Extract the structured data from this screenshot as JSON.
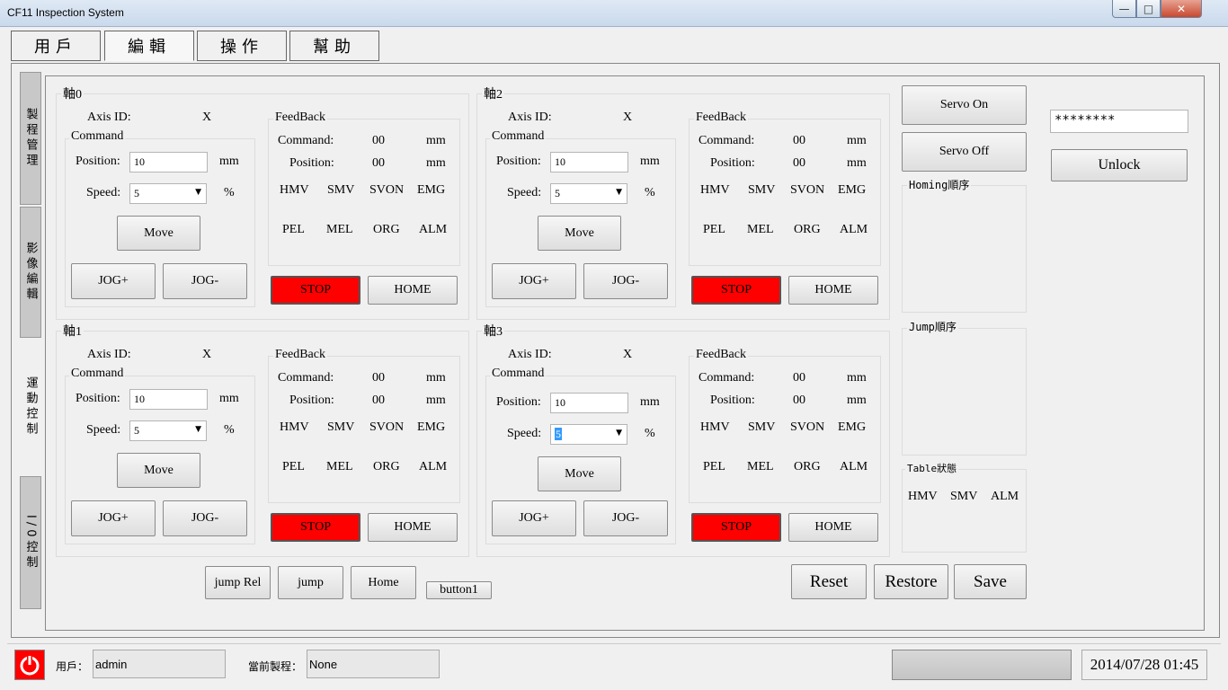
{
  "window": {
    "title": "CF11 Inspection System"
  },
  "menu": {
    "tabs": [
      "用戶",
      "編輯",
      "操作",
      "幫助"
    ]
  },
  "side_tabs": [
    "製程管理",
    "影像編輯",
    "運動控制",
    "I/0控制"
  ],
  "axes": [
    {
      "title": "軸0",
      "axis_id_label": "Axis ID:",
      "axis_id": "X",
      "command_title": "Command",
      "position_label": "Position:",
      "position_value": "10",
      "position_unit": "mm",
      "speed_label": "Speed:",
      "speed_value": "5",
      "speed_unit": "%",
      "move": "Move",
      "jog_plus": "JOG+",
      "jog_minus": "JOG-",
      "feedback_title": "FeedBack",
      "fb_command_label": "Command:",
      "fb_command_value": "00",
      "fb_command_unit": "mm",
      "fb_position_label": "Position:",
      "fb_position_value": "00",
      "fb_position_unit": "mm",
      "flags": [
        "HMV",
        "SMV",
        "SVON",
        "EMG",
        "PEL",
        "MEL",
        "ORG",
        "ALM"
      ],
      "stop": "STOP",
      "home": "HOME"
    },
    {
      "title": "軸1",
      "axis_id_label": "Axis ID:",
      "axis_id": "X",
      "command_title": "Command",
      "position_label": "Position:",
      "position_value": "10",
      "position_unit": "mm",
      "speed_label": "Speed:",
      "speed_value": "5",
      "speed_unit": "%",
      "move": "Move",
      "jog_plus": "JOG+",
      "jog_minus": "JOG-",
      "feedback_title": "FeedBack",
      "fb_command_label": "Command:",
      "fb_command_value": "00",
      "fb_command_unit": "mm",
      "fb_position_label": "Position:",
      "fb_position_value": "00",
      "fb_position_unit": "mm",
      "flags": [
        "HMV",
        "SMV",
        "SVON",
        "EMG",
        "PEL",
        "MEL",
        "ORG",
        "ALM"
      ],
      "stop": "STOP",
      "home": "HOME"
    },
    {
      "title": "軸2",
      "axis_id_label": "Axis ID:",
      "axis_id": "X",
      "command_title": "Command",
      "position_label": "Position:",
      "position_value": "10",
      "position_unit": "mm",
      "speed_label": "Speed:",
      "speed_value": "5",
      "speed_unit": "%",
      "move": "Move",
      "jog_plus": "JOG+",
      "jog_minus": "JOG-",
      "feedback_title": "FeedBack",
      "fb_command_label": "Command:",
      "fb_command_value": "00",
      "fb_command_unit": "mm",
      "fb_position_label": "Position:",
      "fb_position_value": "00",
      "fb_position_unit": "mm",
      "flags": [
        "HMV",
        "SMV",
        "SVON",
        "EMG",
        "PEL",
        "MEL",
        "ORG",
        "ALM"
      ],
      "stop": "STOP",
      "home": "HOME"
    },
    {
      "title": "軸3",
      "axis_id_label": "Axis ID:",
      "axis_id": "X",
      "command_title": "Command",
      "position_label": "Position:",
      "position_value": "10",
      "position_unit": "mm",
      "speed_label": "Speed:",
      "speed_value": "5",
      "speed_unit": "%",
      "move": "Move",
      "jog_plus": "JOG+",
      "jog_minus": "JOG-",
      "feedback_title": "FeedBack",
      "fb_command_label": "Command:",
      "fb_command_value": "00",
      "fb_command_unit": "mm",
      "fb_position_label": "Position:",
      "fb_position_value": "00",
      "fb_position_unit": "mm",
      "flags": [
        "HMV",
        "SMV",
        "SVON",
        "EMG",
        "PEL",
        "MEL",
        "ORG",
        "ALM"
      ],
      "stop": "STOP",
      "home": "HOME"
    }
  ],
  "servo": {
    "on": "Servo On",
    "off": "Servo Off"
  },
  "password": {
    "value": "********"
  },
  "unlock": "Unlock",
  "homing_group": "Homing順序",
  "jump_group": "Jump順序",
  "table_group": {
    "title": "Table狀態",
    "flags": [
      "HMV",
      "SMV",
      "ALM"
    ]
  },
  "bottom_buttons": {
    "jump_rel": "jump Rel",
    "jump": "jump",
    "home": "Home",
    "button1": "button1"
  },
  "actions": {
    "reset": "Reset",
    "restore": "Restore",
    "save": "Save"
  },
  "status": {
    "user_label": "用戶：",
    "user_value": "admin",
    "process_label": "當前製程：",
    "process_value": "None",
    "datetime": "2014/07/28 01:45"
  },
  "colors": {
    "stop": "#ff0000",
    "power": "#ff0000"
  }
}
